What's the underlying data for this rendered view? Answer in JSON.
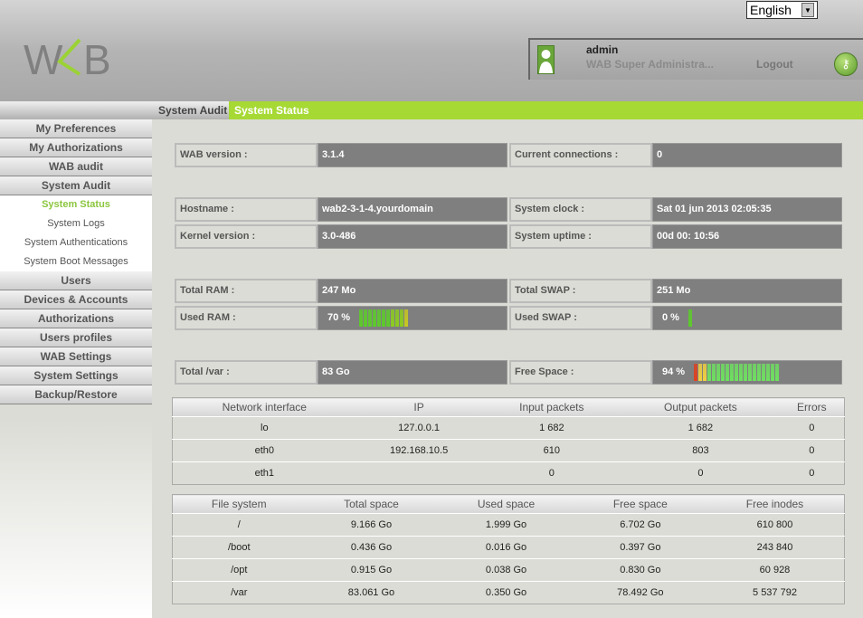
{
  "header": {
    "logo_text": "WAB",
    "language": "English",
    "user": {
      "name": "admin",
      "role": "WAB Super Administra...",
      "logout": "Logout"
    }
  },
  "breadcrumb": [
    "System Audit",
    "System Status"
  ],
  "sidebar": {
    "items": [
      {
        "label": "My Preferences",
        "type": "main"
      },
      {
        "label": "My Authorizations",
        "type": "main"
      },
      {
        "label": "WAB audit",
        "type": "main"
      },
      {
        "label": "System Audit",
        "type": "main"
      },
      {
        "label": "System Status",
        "type": "sub",
        "active": true
      },
      {
        "label": "System Logs",
        "type": "sub"
      },
      {
        "label": "System Authentications",
        "type": "sub"
      },
      {
        "label": "System Boot Messages",
        "type": "sub"
      },
      {
        "label": "Users",
        "type": "main"
      },
      {
        "label": "Devices & Accounts",
        "type": "main"
      },
      {
        "label": "Authorizations",
        "type": "main"
      },
      {
        "label": "Users profiles",
        "type": "main"
      },
      {
        "label": "WAB Settings",
        "type": "main"
      },
      {
        "label": "System Settings",
        "type": "main"
      },
      {
        "label": "Backup/Restore",
        "type": "main"
      }
    ]
  },
  "status": {
    "wab_version": {
      "label": "WAB version :",
      "value": "3.1.4"
    },
    "connections": {
      "label": "Current connections :",
      "value": "0"
    },
    "hostname": {
      "label": "Hostname :",
      "value": "wab2-3-1-4.yourdomain"
    },
    "clock": {
      "label": "System clock :",
      "value": "Sat 01 jun 2013 02:05:35"
    },
    "kernel": {
      "label": "Kernel version :",
      "value": "3.0-486"
    },
    "uptime": {
      "label": "System uptime :",
      "value": "00d 00: 10:56"
    },
    "total_ram": {
      "label": "Total RAM :",
      "value": "247 Mo"
    },
    "total_swap": {
      "label": "Total SWAP :",
      "value": "251 Mo"
    },
    "used_ram": {
      "label": "Used RAM :",
      "value": "70 %",
      "percent": 70
    },
    "used_swap": {
      "label": "Used SWAP :",
      "value": "0 %",
      "percent": 0
    },
    "total_var": {
      "label": "Total /var :",
      "value": "83 Go"
    },
    "free_space": {
      "label": "Free Space :",
      "value": "94 %",
      "percent": 94
    }
  },
  "network": {
    "headers": [
      "Network interface",
      "IP",
      "Input packets",
      "Output packets",
      "Errors"
    ],
    "rows": [
      [
        "lo",
        "127.0.0.1",
        "1 682",
        "1 682",
        "0"
      ],
      [
        "eth0",
        "192.168.10.5",
        "610",
        "803",
        "0"
      ],
      [
        "eth1",
        "",
        "0",
        "0",
        "0"
      ]
    ]
  },
  "filesystems": {
    "headers": [
      "File system",
      "Total space",
      "Used space",
      "Free space",
      "Free inodes"
    ],
    "rows": [
      [
        "/",
        "9.166 Go",
        "1.999 Go",
        "6.702 Go",
        "610 800"
      ],
      [
        "/boot",
        "0.436 Go",
        "0.016 Go",
        "0.397 Go",
        "243 840"
      ],
      [
        "/opt",
        "0.915 Go",
        "0.038 Go",
        "0.830 Go",
        "60 928"
      ],
      [
        "/var",
        "83.061 Go",
        "0.350 Go",
        "78.492 Go",
        "5 537 792"
      ]
    ]
  }
}
